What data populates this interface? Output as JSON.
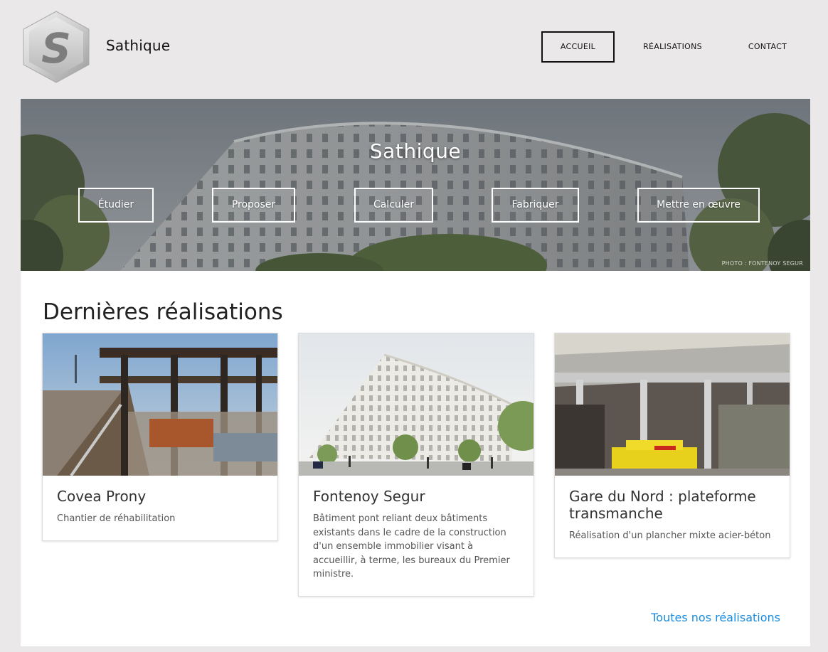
{
  "header": {
    "brand": "Sathique",
    "logo_letter": "S",
    "nav": [
      {
        "label": "Accueil",
        "active": true
      },
      {
        "label": "Réalisations",
        "active": false
      },
      {
        "label": "Contact",
        "active": false
      }
    ]
  },
  "hero": {
    "title": "Sathique",
    "buttons": [
      "Étudier",
      "Proposer",
      "Calculer",
      "Fabriquer",
      "Mettre en œuvre"
    ],
    "credit": "PHOTO : FONTENOY SEGUR"
  },
  "section": {
    "title": "Dernières réalisations",
    "cards": [
      {
        "title": "Covea Prony",
        "desc": "Chantier de réhabilitation"
      },
      {
        "title": "Fontenoy Segur",
        "desc": "Bâtiment pont reliant deux bâtiments existants dans le cadre de la construction d'un ensemble immobilier visant à accueillir, à terme, les bureaux du Premier ministre."
      },
      {
        "title": "Gare du Nord : plateforme transmanche",
        "desc": "Réalisation d'un plancher mixte acier-béton"
      }
    ],
    "all_link": "Toutes nos réalisations"
  },
  "colors": {
    "page_bg": "#eae8e9",
    "link": "#1a8be0",
    "panel_bg": "#ffffff"
  }
}
